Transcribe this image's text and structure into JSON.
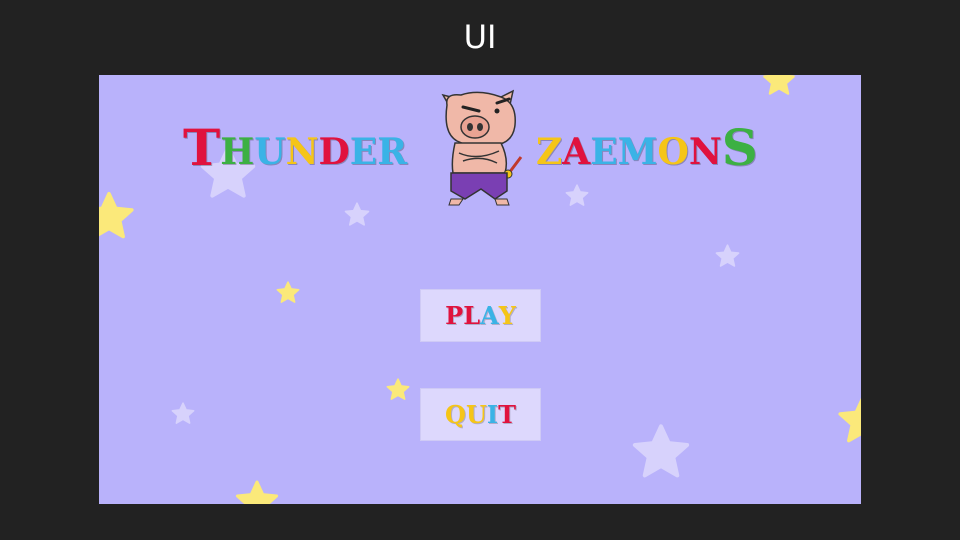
{
  "slide": {
    "title": "UI"
  },
  "logo": {
    "left_word": [
      "T",
      "H",
      "U",
      "N",
      "D",
      "E",
      "R"
    ],
    "right_word": [
      "Z",
      "A",
      "E",
      "M",
      "O",
      "N",
      "S"
    ],
    "left_colors": [
      "#e0123e",
      "#3ab3e6",
      "#3ab3e6",
      "#f5c518",
      "#e0123e",
      "#3ab3e6",
      "#3ab3e6"
    ],
    "right_colors": [
      "#f5c518",
      "#e0123e",
      "#3ab3e6",
      "#3ab3e6",
      "#f5c518",
      "#e0123e",
      "#3cb043"
    ]
  },
  "menu": {
    "play": {
      "letters": [
        "P",
        "L",
        "A",
        "Y"
      ],
      "colors": [
        "#e0123e",
        "#e0123e",
        "#3ab3e6",
        "#f5c518"
      ]
    },
    "quit": {
      "letters": [
        "Q",
        "U",
        "I",
        "T"
      ],
      "colors": [
        "#f5c518",
        "#f5c518",
        "#3ab3e6",
        "#e0123e"
      ]
    }
  },
  "colors": {
    "background": "#b9b2fb",
    "star_yellow": "#fbe97a",
    "star_pale": "#d7d2fc",
    "button_bg": "#ddd8fd"
  }
}
